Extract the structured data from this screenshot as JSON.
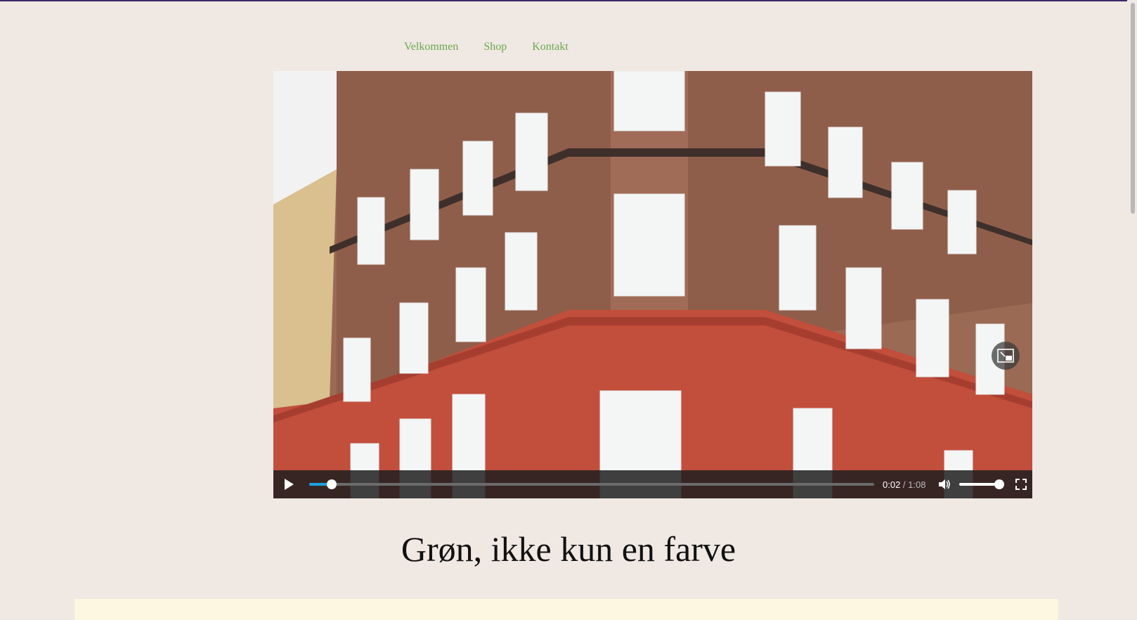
{
  "nav": {
    "items": [
      "Velkommen",
      "Shop",
      "Kontakt"
    ]
  },
  "video": {
    "current_time": "0:02",
    "separator": " / ",
    "duration": "1:08",
    "progress_fraction": 0.04,
    "volume_fraction": 1.0,
    "accent_color": "#1ba1e2"
  },
  "page": {
    "title": "Grøn, ikke kun en farve"
  },
  "colors": {
    "background": "#f0e8e3",
    "nav_link": "#6aa84f",
    "panel": "#fdf6e0"
  }
}
